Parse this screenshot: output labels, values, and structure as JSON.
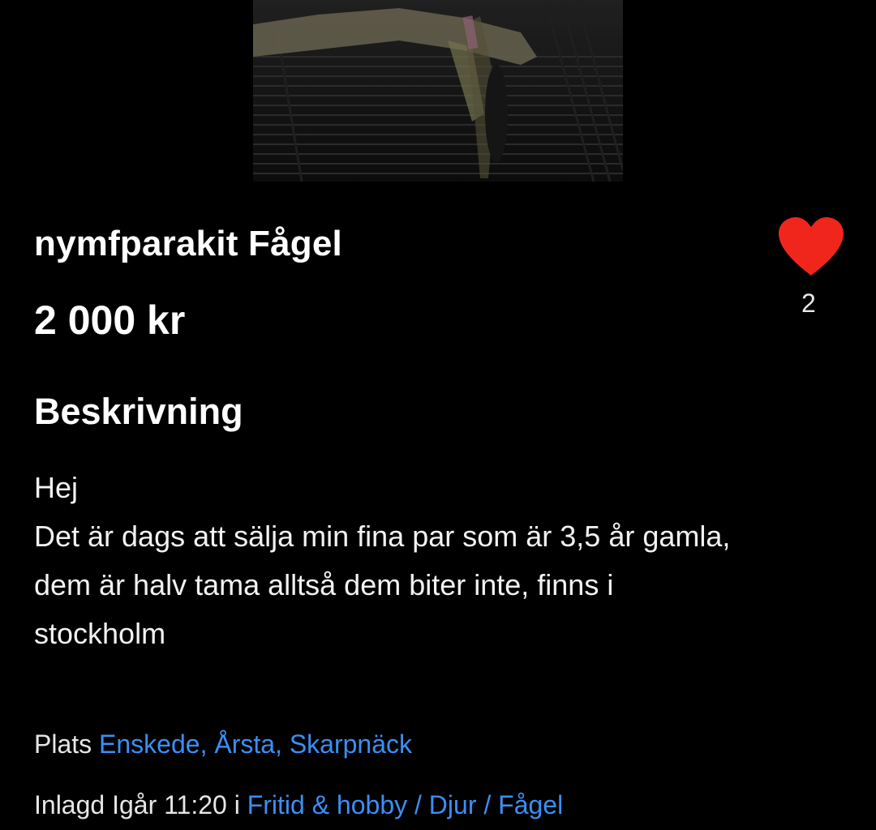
{
  "listing": {
    "title": "nymfparakit Fågel",
    "price": "2 000 kr",
    "favorite_count": "2",
    "favorite_color": "#f0261c"
  },
  "description": {
    "heading": "Beskrivning",
    "lines": [
      "Hej",
      "Det är dags att sälja min fina par som är 3,5 år gamla,",
      "dem är halv tama alltså dem biter inte, finns i",
      "stockholm"
    ]
  },
  "location": {
    "label": "Plats",
    "value": "Enskede, Årsta, Skarpnäck"
  },
  "posted": {
    "label": "Inlagd Igår 11:20 i",
    "category_path": "Fritid & hobby / Djur / Fågel"
  },
  "colors": {
    "background": "#000000",
    "text": "#ffffff",
    "link": "#3b8ff5"
  }
}
